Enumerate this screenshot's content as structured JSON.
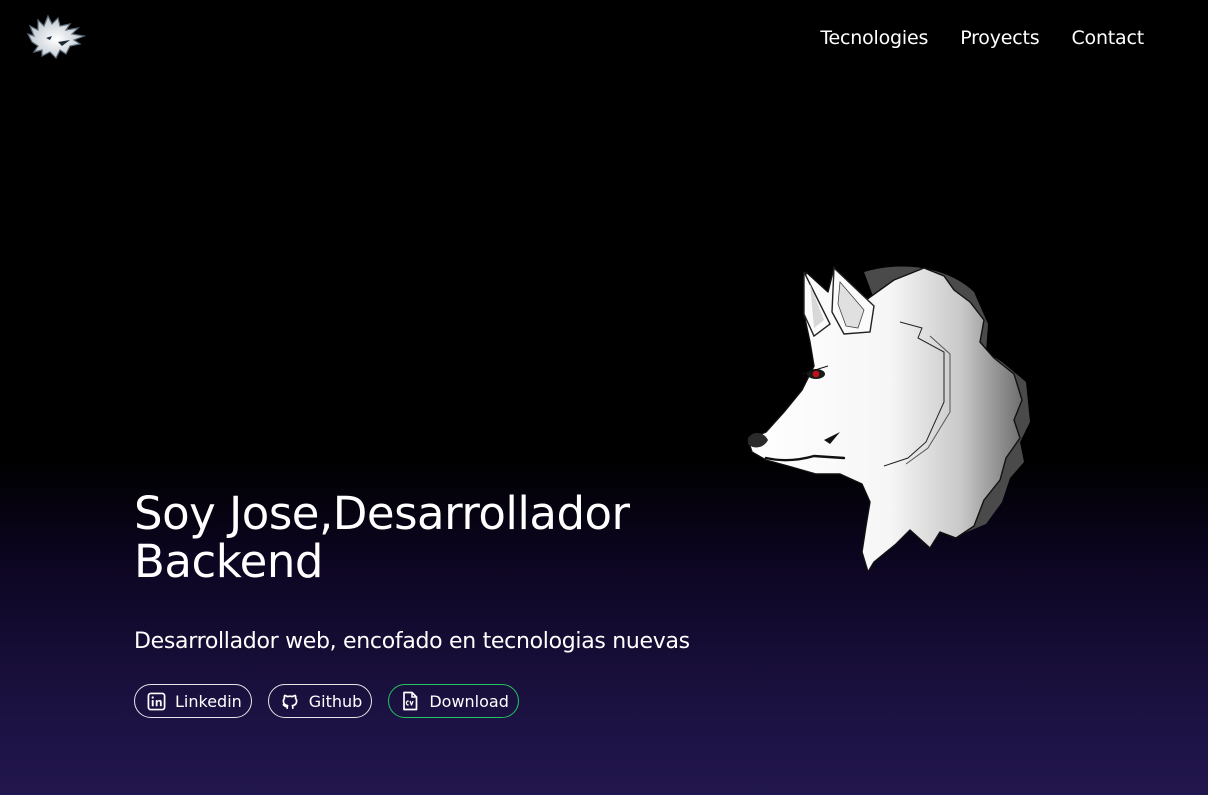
{
  "header": {
    "logo_icon": "wolf-logo-icon",
    "nav": [
      {
        "label": "Tecnologies"
      },
      {
        "label": "Proyects"
      },
      {
        "label": "Contact"
      }
    ]
  },
  "hero": {
    "title": "Soy Jose,Desarrollador Backend",
    "subtitle": "Desarrollador web, encofado en tecnologias nuevas",
    "buttons": [
      {
        "label": "Linkedin",
        "icon": "linkedin-icon"
      },
      {
        "label": "Github",
        "icon": "github-icon"
      },
      {
        "label": "Download",
        "icon": "cv-file-icon"
      }
    ],
    "illustration": "white-wolf-head-illustration"
  },
  "colors": {
    "background_top": "#000000",
    "background_bottom": "#22164e",
    "text": "#ffffff",
    "download_border": "#22c55e",
    "wolf_eye": "#c0101a"
  }
}
